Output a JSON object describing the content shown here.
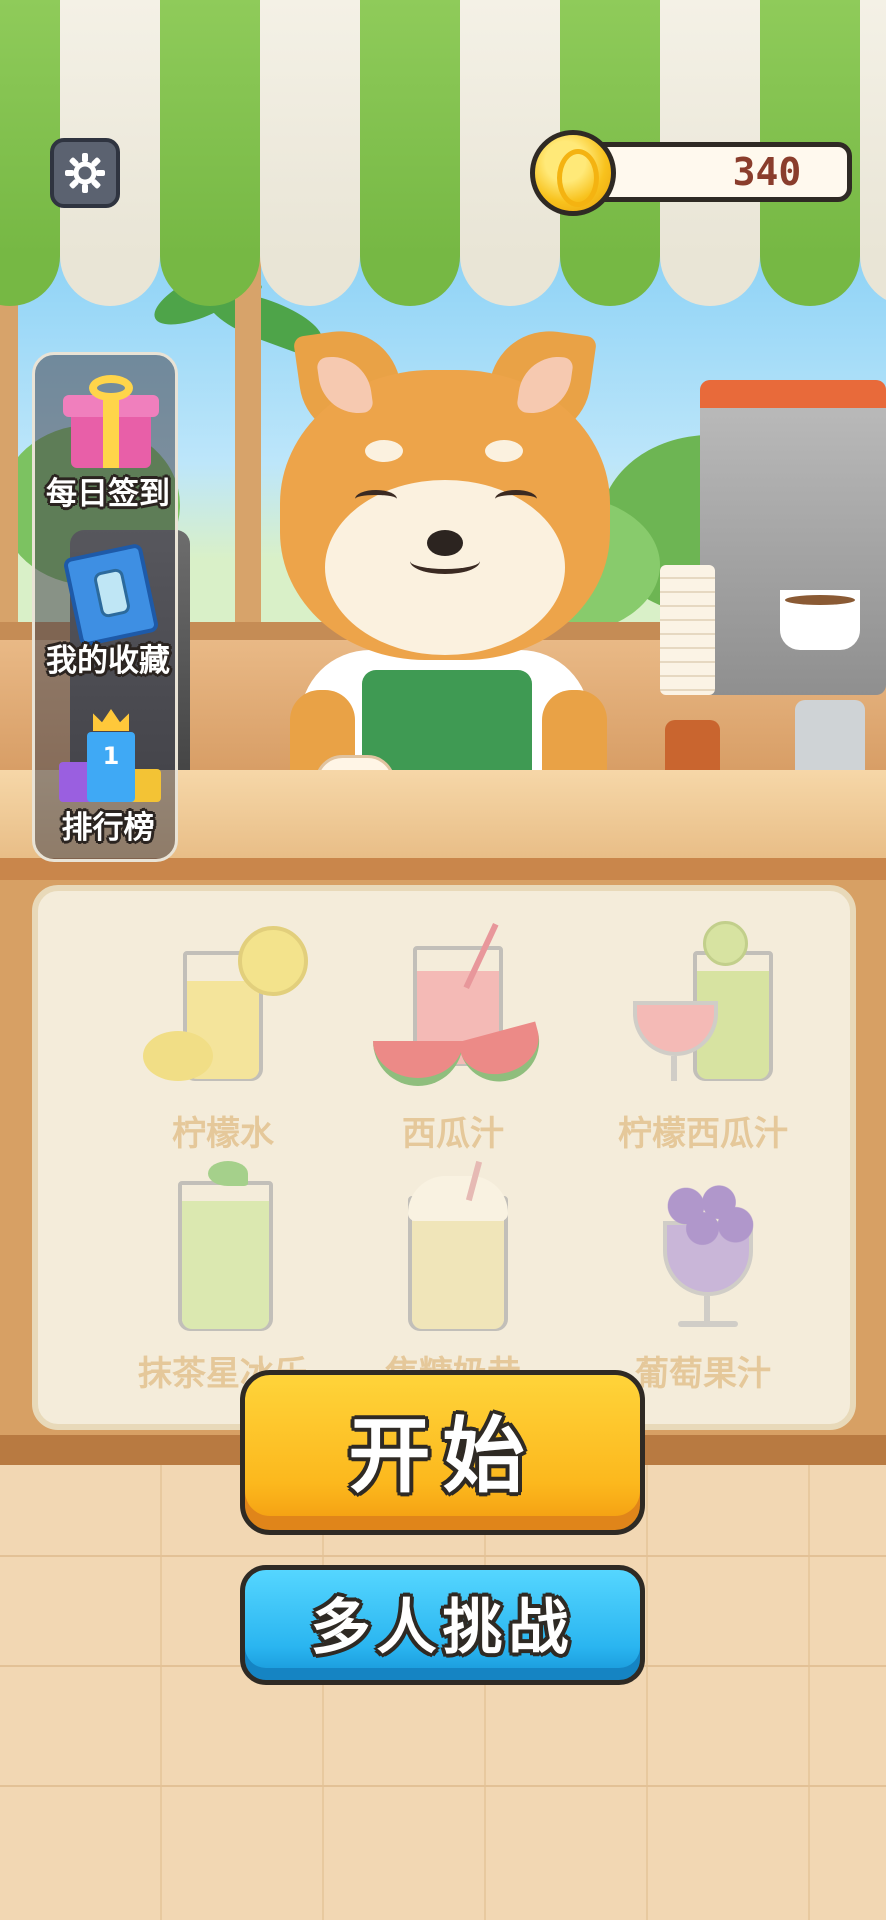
{
  "hud": {
    "coins": "340",
    "settings_icon": "gear-icon",
    "coin_icon": "gold-coin-icon"
  },
  "side_menu": [
    {
      "label": "每日签到",
      "icon": "gift-icon"
    },
    {
      "label": "我的收藏",
      "icon": "collection-book-icon"
    },
    {
      "label": "排行榜",
      "icon": "leaderboard-trophy-icon"
    }
  ],
  "drinks": [
    {
      "label": "柠檬水",
      "icon": "lemonade-icon",
      "color": "#f5e17a"
    },
    {
      "label": "西瓜汁",
      "icon": "watermelon-juice-icon",
      "color": "#f4a0a4"
    },
    {
      "label": "柠檬西瓜汁",
      "icon": "lemon-watermelon-juice-icon",
      "color": "#c8df84"
    },
    {
      "label": "抹茶星冰乐",
      "icon": "matcha-frappe-icon",
      "color": "#cfe79a"
    },
    {
      "label": "焦糖奶昔",
      "icon": "caramel-shake-icon",
      "color": "#efe2a8"
    },
    {
      "label": "葡萄果汁",
      "icon": "grape-juice-icon",
      "color": "#b39ad8"
    }
  ],
  "buttons": {
    "start": "开始",
    "multiplayer": "多人挑战"
  },
  "colors": {
    "start_button": "#fcb81d",
    "multiplayer_button": "#2ab5f0",
    "awning_green": "#76b844",
    "coin_text": "#8a3d2c"
  }
}
